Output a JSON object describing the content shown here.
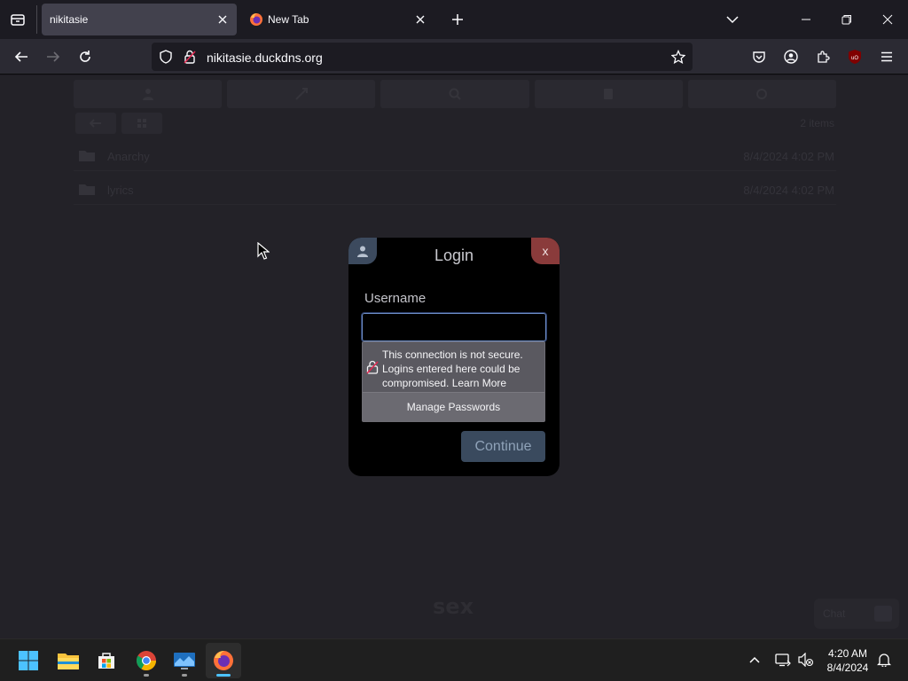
{
  "browser": {
    "tabs": [
      {
        "label": "nikitasie",
        "active": true
      },
      {
        "label": "New Tab",
        "active": false
      }
    ],
    "url": "nikitasie.duckdns.org",
    "extension_badge": "uO"
  },
  "page": {
    "brand": "sex",
    "corner_widget_label": "Chat",
    "files": [
      {
        "name": "Anarchy",
        "meta": "8/4/2024 4:02 PM"
      },
      {
        "name": "lyrics",
        "meta": "8/4/2024 4:02 PM"
      }
    ],
    "file_count": "2 items"
  },
  "dialog": {
    "title": "Login",
    "close_label": "x",
    "username_label": "Username",
    "username_value": "",
    "password_popup": {
      "warning": "This connection is not secure. Logins entered here could be compromised.",
      "learn_more": "Learn More",
      "manage": "Manage Passwords"
    },
    "continue_label": "Continue"
  },
  "taskbar": {
    "apps": [
      "Start",
      "File Explorer",
      "Microsoft Store",
      "Google Chrome",
      "Remote app",
      "Firefox"
    ],
    "time": "4:20 AM",
    "date": "8/4/2024"
  },
  "colors": {
    "dialog_close": "#8a3b3b",
    "dialog_user_tab": "#3c4a5e",
    "continue_button": "#3a4a5e",
    "accent": "#4cc2ff"
  }
}
